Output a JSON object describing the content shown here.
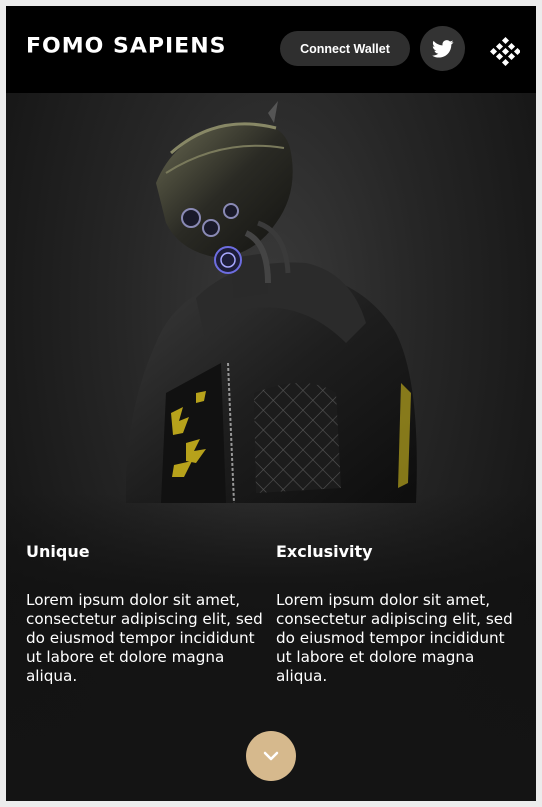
{
  "header": {
    "logo_text": "FOMO SAPIENS",
    "connect_wallet_label": "Connect Wallet",
    "twitter_icon": "twitter-bird-icon",
    "menu_icon": "diamond-grid-menu-icon"
  },
  "hero": {
    "image": "cyberpunk-character-in-leather-jacket-and-mask"
  },
  "features": [
    {
      "title": "Unique",
      "text": "Lorem ipsum dolor sit amet, consectetur adipiscing elit, sed do eiusmod tempor incididunt ut labore et dolore magna aliqua."
    },
    {
      "title": "Exclusivity",
      "text": "Lorem ipsum dolor sit amet, consectetur adipiscing elit, sed do eiusmod tempor incididunt ut labore et dolore magna aliqua."
    }
  ],
  "scroll_button": {
    "icon": "chevron-down-icon"
  },
  "colors": {
    "header_bg": "#000000",
    "button_dark": "#2f2f2f",
    "scroll_accent": "#d6b98d",
    "text": "#ffffff"
  }
}
